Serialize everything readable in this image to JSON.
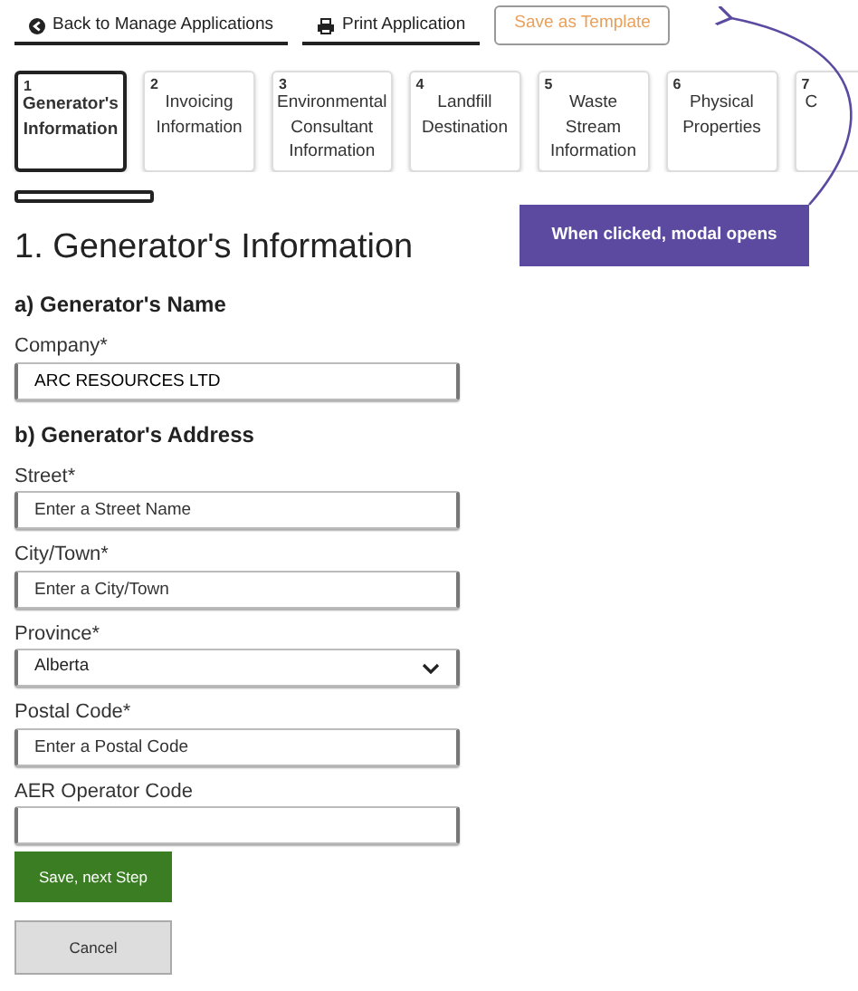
{
  "toolbar": [
    {
      "kind": "back",
      "label": "Back to Manage Applications"
    },
    {
      "kind": "print",
      "label": "Print Application"
    },
    {
      "kind": "template",
      "label": "Save as Template"
    }
  ],
  "steps": [
    {
      "number": "1",
      "label": "Generator's Information",
      "selected": true
    },
    {
      "number": "2",
      "label": "Invoicing Information",
      "selected": false
    },
    {
      "number": "3",
      "label": "Environmental Consultant Information",
      "selected": false
    },
    {
      "number": "4",
      "label": "Landfill Destination",
      "selected": false
    },
    {
      "number": "5",
      "label": "Waste Stream Information",
      "selected": false
    },
    {
      "number": "6",
      "label": "Physical Properties",
      "selected": false
    },
    {
      "number": "7",
      "label": "C",
      "selected": false
    }
  ],
  "progress": {
    "level": 0
  },
  "annotation": {
    "text": "When clicked, modal opens"
  },
  "title": "1. Generator's Information",
  "sections": [
    {
      "heading": "a) Generator's Name",
      "fields": [
        {
          "kind": "text",
          "label": "Company*",
          "value": "ARC RESOURCES LTD"
        }
      ]
    },
    {
      "heading": "b) Generator's Address",
      "fields": [
        {
          "kind": "text",
          "label": "Street*",
          "placeholder": "Enter a Street Name"
        },
        {
          "kind": "text",
          "label": "City/Town*",
          "placeholder": "Enter a City/Town"
        },
        {
          "kind": "select",
          "label": "Province*",
          "value": "Alberta"
        },
        {
          "kind": "text",
          "label": "Postal Code*",
          "placeholder": "Enter a Postal Code"
        },
        {
          "kind": "text",
          "label": "AER Operator Code"
        }
      ]
    }
  ],
  "buttons": [
    {
      "kind": "primary",
      "label": "Save, next Step"
    },
    {
      "kind": "secondary",
      "label": "Cancel"
    }
  ]
}
